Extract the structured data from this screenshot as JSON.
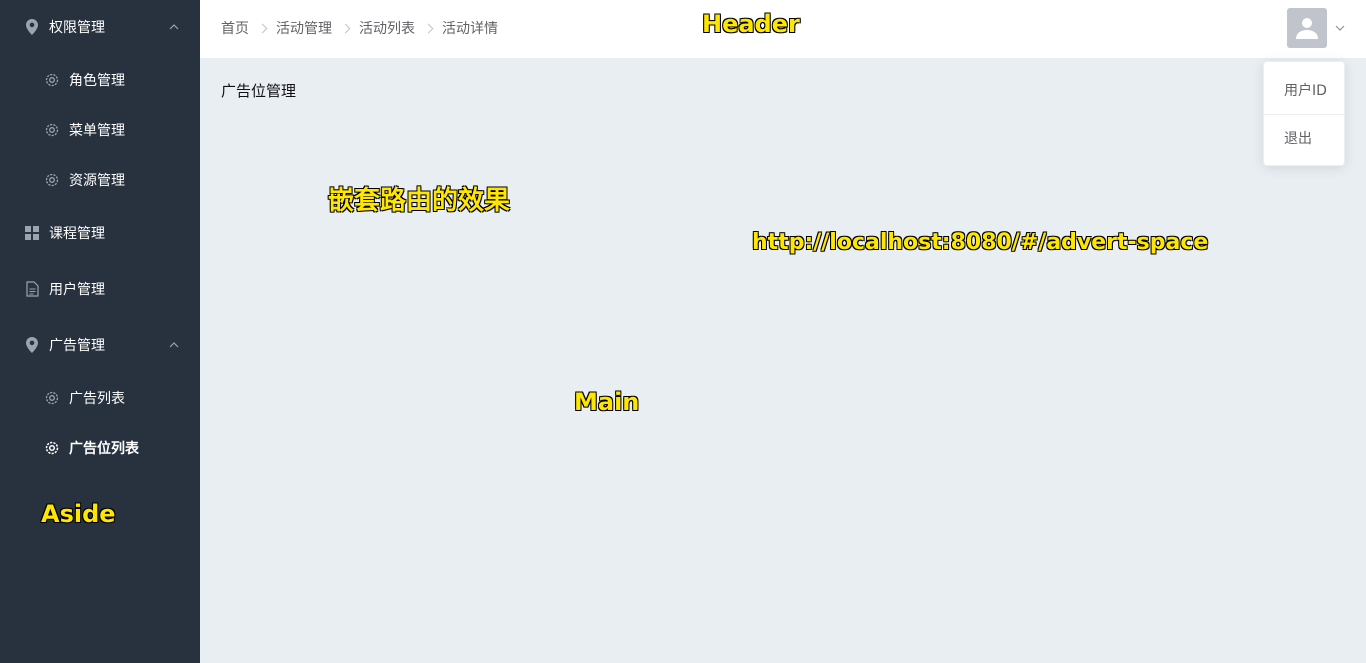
{
  "aside": {
    "menu": [
      {
        "label": "权限管理",
        "icon": "location-icon",
        "expanded": true
      },
      {
        "label": "角色管理",
        "icon": "gear-icon"
      },
      {
        "label": "菜单管理",
        "icon": "gear-icon"
      },
      {
        "label": "资源管理",
        "icon": "gear-icon"
      },
      {
        "label": "课程管理",
        "icon": "grid-icon"
      },
      {
        "label": "用户管理",
        "icon": "document-icon"
      },
      {
        "label": "广告管理",
        "icon": "location-icon",
        "expanded": true
      },
      {
        "label": "广告列表",
        "icon": "gear-icon"
      },
      {
        "label": "广告位列表",
        "icon": "gear-icon",
        "active": true
      }
    ],
    "annotation": "Aside"
  },
  "header": {
    "breadcrumb": [
      "首页",
      "活动管理",
      "活动列表",
      "活动详情"
    ],
    "annotation": "Header",
    "user_menu": {
      "items": [
        "用户ID",
        "退出"
      ]
    }
  },
  "main": {
    "title": "广告位管理",
    "annotations": {
      "nested": "嵌套路由的效果",
      "url": "http://localhost:8080/#/advert-space",
      "main": "Main"
    }
  },
  "colors": {
    "aside_bg": "#28323f",
    "main_bg": "#e9eef3",
    "annotation": "#ffe600"
  }
}
